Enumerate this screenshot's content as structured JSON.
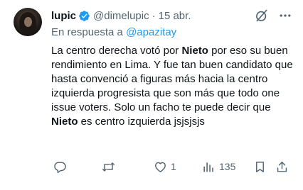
{
  "tweet": {
    "author": {
      "display_name": "lupic",
      "handle": "@dimelupic",
      "separator": "·",
      "date": "15 abr.",
      "verified_icon": "verified-badge-icon"
    },
    "reply": {
      "prefix": "En respuesta a ",
      "mention": "@apazitay"
    },
    "text_segments": {
      "s1": "La centro derecha votó por ",
      "b1": "Nieto",
      "s2": " por eso su buen rendimiento en Lima. Y fue tan buen candidato que hasta convenció a figuras más hacia la centro izquierda progresista que son más que todo one issue voters. Solo un facho te puede decir que ",
      "b2": "Nieto",
      "s3": " es centro izquierda jsjsjsjs"
    },
    "actions": {
      "reply_icon": "reply-icon",
      "retweet_icon": "retweet-icon",
      "like_icon": "heart-icon",
      "like_count": "1",
      "views_icon": "views-chart-icon",
      "views_count": "135",
      "bookmark_icon": "bookmark-icon",
      "share_icon": "share-icon"
    },
    "colors": {
      "accent": "#1d9bf0",
      "muted": "#536471",
      "text": "#0f1419"
    }
  }
}
